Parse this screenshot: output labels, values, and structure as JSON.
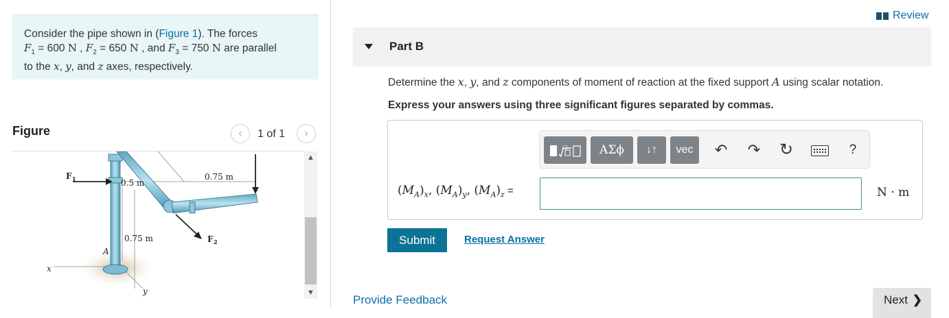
{
  "problem": {
    "intro": "Consider the pipe shown in (",
    "figure_link": "Figure 1",
    "intro_after": "). The forces",
    "f1_sym": "F",
    "f1_sub": "1",
    "f1_val": " = 600 ",
    "unit_n": "N",
    "sep1": " , ",
    "f2_sym": "F",
    "f2_sub": "2",
    "f2_val": " = 650 ",
    "sep2": " , and ",
    "f3_sym": "F",
    "f3_sub": "3",
    "f3_val": " = 750 ",
    "tail": " are parallel",
    "line3_a": "to the ",
    "x": "x",
    "y": "y",
    "z": "z",
    "comma": ", ",
    "and": ", and ",
    "line3_end": " axes, respectively."
  },
  "figure": {
    "title": "Figure",
    "counter": "1 of 1",
    "prev_icon": "‹",
    "next_icon": "›",
    "labels": {
      "f1": "F",
      "f1_sub": "1",
      "f2": "F",
      "f2_sub": "2",
      "dim_05": "0.5 m",
      "dim_075_top": "0.75 m",
      "dim_075_left": "0.75 m",
      "point_a": "A",
      "axis_x": "x",
      "axis_y": "y"
    },
    "scroll_up": "▲",
    "scroll_down": "▼"
  },
  "review": {
    "label": "Review"
  },
  "part": {
    "title": "Part B"
  },
  "question": {
    "pre": "Determine the ",
    "x": "x",
    "c1": ", ",
    "y": "y",
    "c2": ", and ",
    "z": "z",
    "mid": " components of moment of reaction at the fixed support ",
    "a": "A",
    "end": " using scalar notation."
  },
  "instruction": "Express your answers using three significant figures separated by commas.",
  "toolbar": {
    "templates_icon": "templates-icon",
    "greek_label": "ΑΣϕ",
    "arrows_label": "↓↑",
    "vec_label": "vec",
    "undo": "↶",
    "redo": "↷",
    "reset": "↻",
    "help": "?"
  },
  "answer": {
    "label_m": "M",
    "sub_a": "A",
    "sub_x": "x",
    "sub_y": "y",
    "sub_z": "z",
    "equals": " =",
    "value": "",
    "unit": "N · m"
  },
  "actions": {
    "submit": "Submit",
    "request": "Request Answer",
    "feedback": "Provide Feedback",
    "next": "Next",
    "next_chev": "❯"
  }
}
